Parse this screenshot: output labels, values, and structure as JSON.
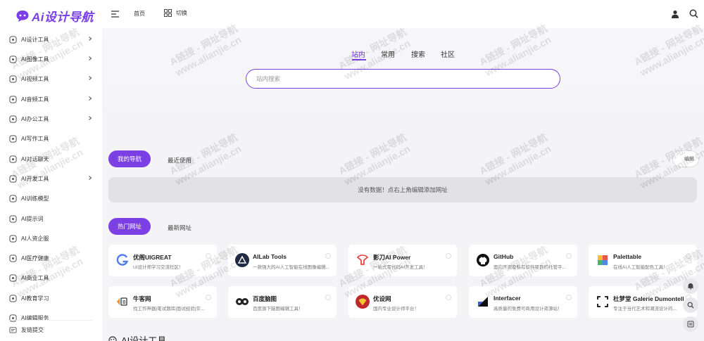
{
  "brand": {
    "name": "Ai设计导航",
    "accent": "#7b3fe4"
  },
  "topbar": {
    "home": "首页",
    "switch": "切换"
  },
  "sidebar": {
    "items": [
      {
        "label": "AI设计工具",
        "icon": "palette-icon",
        "has_arrow": true
      },
      {
        "label": "AI图像工具",
        "icon": "image-icon",
        "has_arrow": true
      },
      {
        "label": "AI视频工具",
        "icon": "video-icon",
        "has_arrow": true
      },
      {
        "label": "AI音频工具",
        "icon": "audio-icon",
        "has_arrow": true
      },
      {
        "label": "AI办公工具",
        "icon": "office-icon",
        "has_arrow": true
      },
      {
        "label": "AI写作工具",
        "icon": "writing-icon",
        "has_arrow": false
      },
      {
        "label": "AI对话聊天",
        "icon": "chat-icon",
        "has_arrow": false
      },
      {
        "label": "AI开发工具",
        "icon": "code-icon",
        "has_arrow": true
      },
      {
        "label": "AI训练模型",
        "icon": "model-icon",
        "has_arrow": false
      },
      {
        "label": "AI提示词",
        "icon": "prompt-icon",
        "has_arrow": false
      },
      {
        "label": "AI人资企服",
        "icon": "hr-icon",
        "has_arrow": false
      },
      {
        "label": "AI医疗健康",
        "icon": "health-icon",
        "has_arrow": false
      },
      {
        "label": "AI商业工具",
        "icon": "business-icon",
        "has_arrow": false
      },
      {
        "label": "AI教育学习",
        "icon": "education-icon",
        "has_arrow": false
      },
      {
        "label": "AI编辑服务",
        "icon": "edit-icon",
        "has_arrow": false
      }
    ],
    "submit": "友链提交"
  },
  "search": {
    "tabs": [
      "站内",
      "常用",
      "搜索",
      "社区"
    ],
    "active_tab": 0,
    "placeholder": "站内搜索"
  },
  "my_nav": {
    "tabs": [
      "我的导航",
      "最近使用"
    ],
    "edit_label": "编辑",
    "empty_text": "没有数据！点右上角编辑添加网址"
  },
  "hot": {
    "tabs": [
      "热门网址",
      "最新网址"
    ],
    "cards": [
      {
        "title": "优阁UIGREAT",
        "desc": "UI设计师学习交流社区！",
        "logo": "uigreat-logo"
      },
      {
        "title": "AILab Tools",
        "desc": "一款强大的AI人工智能在线图像编辑...",
        "logo": "ailab-logo"
      },
      {
        "title": "影刀AI Power",
        "desc": "一站式零代码AI开发工具！",
        "logo": "yingdao-logo"
      },
      {
        "title": "GitHub",
        "desc": "面向开源及私有软件项目的托管平...",
        "logo": "github-logo"
      },
      {
        "title": "Palettable",
        "desc": "在线AI人工智能配色工具！",
        "logo": "palettable-logo"
      },
      {
        "title": "牛客网",
        "desc": "找工作神器|笔试题库|面试经验|实...",
        "logo": "nowcoder-logo"
      },
      {
        "title": "百度脑图",
        "desc": "百度旗下脑图编辑工具！",
        "logo": "naotu-logo"
      },
      {
        "title": "优设网",
        "desc": "国内专业设计师平台！",
        "logo": "uisdc-logo"
      },
      {
        "title": "Interfacer",
        "desc": "高质量的免费可商用设计资源站！",
        "logo": "interfacer-logo"
      },
      {
        "title": "杜梦堂 Galerie Dumontell",
        "desc": "专注于当代艺术和潮流设计的...",
        "logo": "dumontell-logo"
      }
    ]
  },
  "section": {
    "title": "AI设计工具"
  },
  "watermark": {
    "line1": "A链接 - 网址导航",
    "line2": "www.alianjie.cn"
  }
}
